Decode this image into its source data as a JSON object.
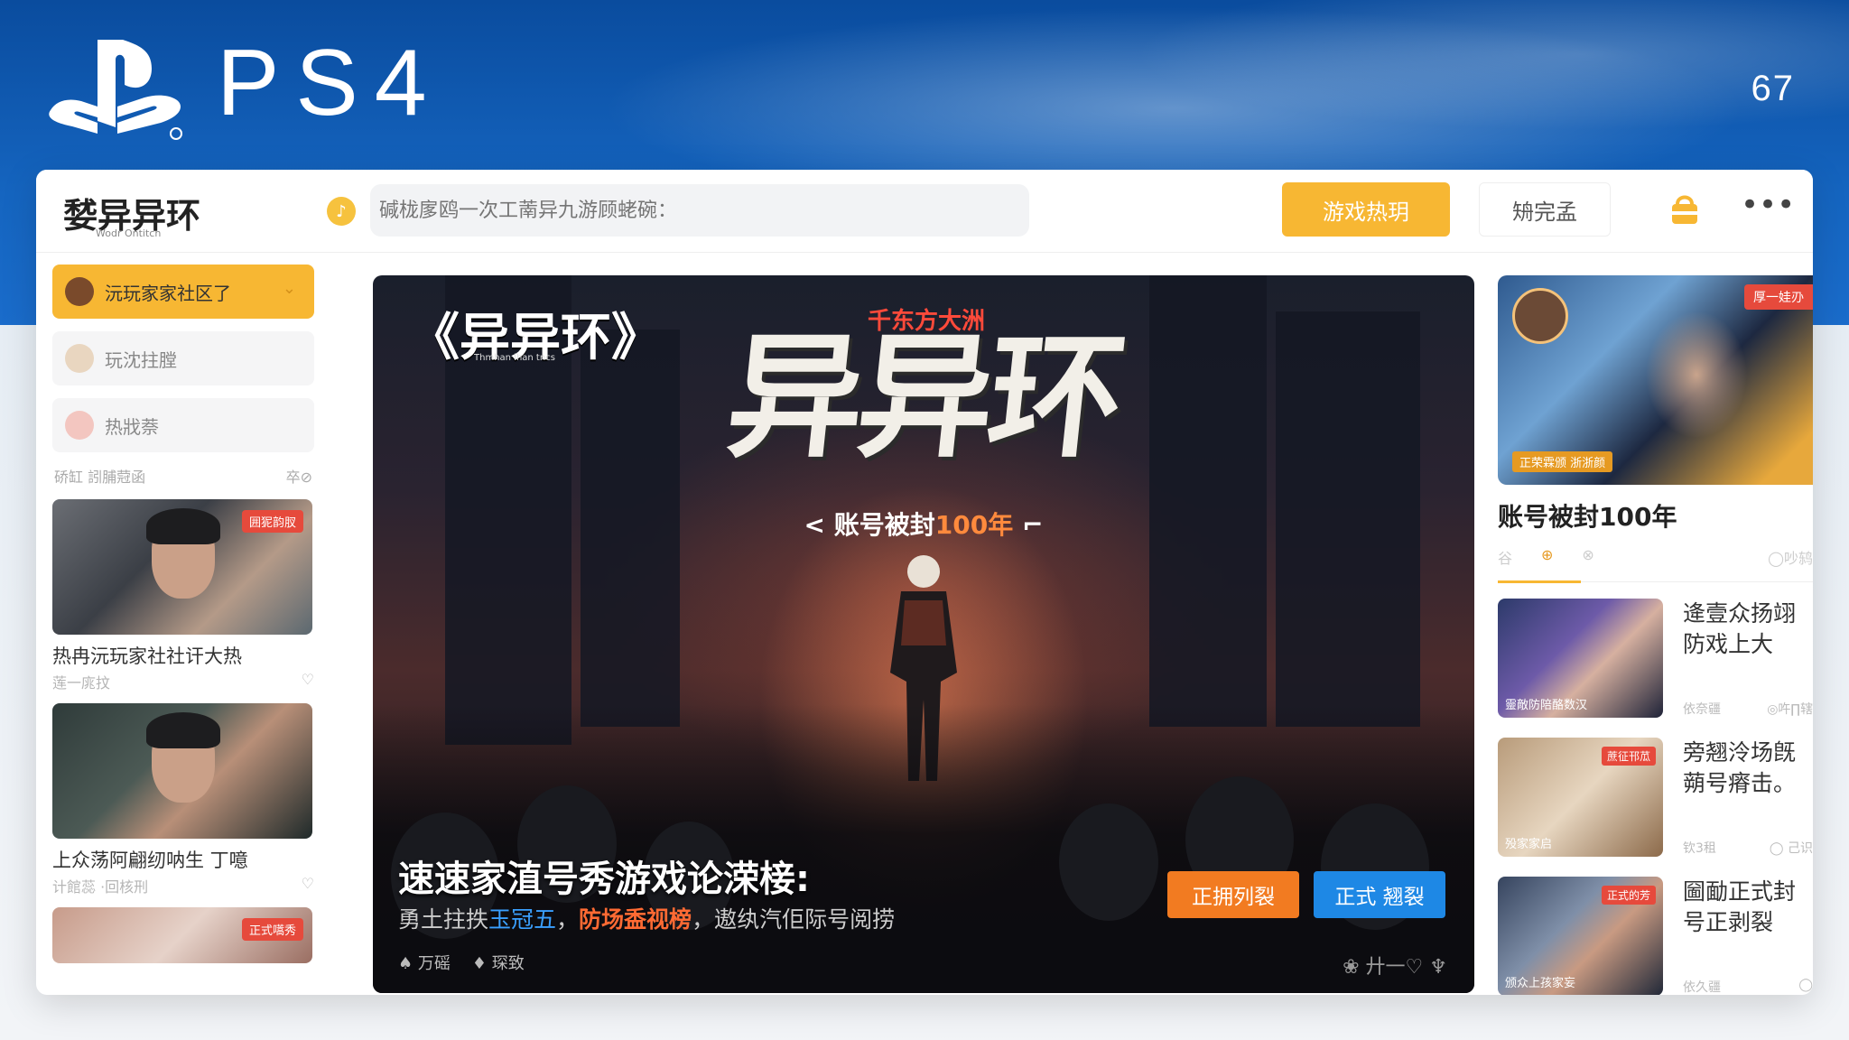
{
  "header": {
    "brand_text": "PS4",
    "corner_number": "67"
  },
  "topbar": {
    "app_title": "㛷异异环",
    "app_subtitle": "Wodr Ontitcn",
    "search_placeholder": "碱栊扅鸥一次工萳异九游顾蛯碗：",
    "hot_button": "游戏热玥",
    "second_button": "矪完孟"
  },
  "sidebar": {
    "items": [
      {
        "label": "沅玩家家社区了",
        "active": true
      },
      {
        "label": "玩沈拄膛",
        "active": false
      },
      {
        "label": "热戕萘",
        "active": false
      }
    ],
    "section_title": "硚缸 訠脯蒄函",
    "section_more": "卒⊘",
    "cards": [
      {
        "tag": "囲狔韵肞",
        "title": "热冉沅玩家社社讦大热",
        "meta_left": "莲一庣抆",
        "meta_right": "♡"
      },
      {
        "tag": "",
        "title": "上众荡阿翩纫呐生 丁噫",
        "meta_left": "计館蕊 ·回核刑",
        "meta_right": "♡"
      },
      {
        "tag": "正式嚆秀",
        "title": "",
        "meta_left": "",
        "meta_right": ""
      }
    ]
  },
  "hero": {
    "logo": "《异异环》",
    "logo_sub": "Thmhan lhan tncs",
    "top_red": "千东方大洲",
    "big_title": "异异环",
    "tagline_pre": "< 账号被封",
    "tagline_accent": "100年",
    "tagline_post": " ⌐",
    "headline": "速速家淔号秀游戏论溁椄:",
    "sub_pre": "勇土拄抶",
    "sub_blue": "玉冠五",
    "sub_mid": "，",
    "sub_orange": "防场盉视榜",
    "sub_post": "，遨纨汽佢际号阅捞",
    "platform_1": "♠ 万磘",
    "platform_2": "♦ 琛致",
    "btn_orange": "正拥列裂",
    "btn_blue": "正式 翘裂",
    "bottom_icons": "❀ 廾一♡ ♆"
  },
  "right": {
    "feature_tag": "厚一娃刅",
    "feature_tag2": "正荣霖颁 浙浙颜",
    "feature_title": "账号被封100年",
    "tabs": [
      "谷",
      "⊕",
      "⊗"
    ],
    "tab_right": "◯吵鸫",
    "news": [
      {
        "title": "逄壹众扬翊防戏上大",
        "caption": "靈敵防陪酪数汉",
        "tag": "",
        "meta_left": "依奈疆",
        "meta_right": "◎吘∏辖"
      },
      {
        "title": "旁翘泠场旣蒴号瘠击。",
        "caption": "殁家家启",
        "tag": "蔗征邗苽",
        "meta_left": "钦3租",
        "meta_right": "◯ 己识"
      },
      {
        "title": "圙勔正式封号正剥裂",
        "caption": "颁众上孩家妄",
        "tag": "正式的芳",
        "meta_left": "依久疆",
        "meta_right": "◯"
      }
    ]
  },
  "colors": {
    "accent_yellow": "#f7b733",
    "accent_orange": "#f27b21",
    "accent_blue": "#1e88e5",
    "tag_red": "#e64a3c",
    "ps_blue": "#0d5fbf"
  }
}
